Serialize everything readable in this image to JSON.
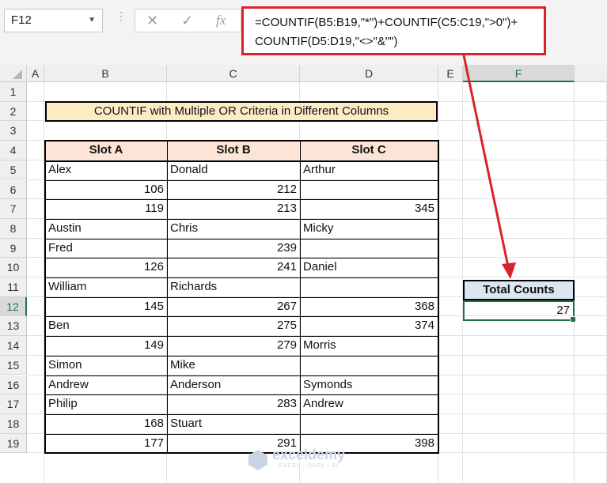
{
  "namebox": {
    "ref": "F12"
  },
  "formula_bar": {
    "fx_label": "fx",
    "text_line1": "=COUNTIF(B5:B19,\"*\")+COUNTIF(C5:C19,\">0\")+",
    "text_line2": "COUNTIF(D5:D19,\"<>\"&\"\")"
  },
  "columns": [
    "A",
    "B",
    "C",
    "D",
    "E",
    "F"
  ],
  "rows": [
    "1",
    "2",
    "3",
    "4",
    "5",
    "6",
    "7",
    "8",
    "9",
    "10",
    "11",
    "12",
    "13",
    "14",
    "15",
    "16",
    "17",
    "18",
    "19"
  ],
  "title": "COUNTIF with Multiple OR Criteria in Different Columns",
  "table": {
    "headers": [
      "Slot A",
      "Slot B",
      "Slot C"
    ],
    "rows": [
      [
        "Alex",
        "Donald",
        "Arthur"
      ],
      [
        "106",
        "212",
        ""
      ],
      [
        "119",
        "213",
        "345"
      ],
      [
        "Austin",
        "Chris",
        "Micky"
      ],
      [
        "Fred",
        "239",
        ""
      ],
      [
        "126",
        "241",
        "Daniel"
      ],
      [
        "William",
        "Richards",
        ""
      ],
      [
        "145",
        "267",
        "368"
      ],
      [
        "Ben",
        "275",
        "374"
      ],
      [
        "149",
        "279",
        "Morris"
      ],
      [
        "Simon",
        "Mike",
        ""
      ],
      [
        "Andrew",
        "Anderson",
        "Symonds"
      ],
      [
        "Philip",
        "283",
        "Andrew"
      ],
      [
        "168",
        "Stuart",
        ""
      ],
      [
        "177",
        "291",
        "398"
      ]
    ]
  },
  "result": {
    "header": "Total Counts",
    "value": "27"
  },
  "watermark": {
    "name": "exceldemy",
    "tagline": "EXCEL · DATA · BI"
  },
  "colors": {
    "accent_red": "#d9232a",
    "excel_green": "#217346",
    "title_fill": "#fdebc4",
    "header_fill": "#fce4d6",
    "total_fill": "#dce6f1"
  }
}
